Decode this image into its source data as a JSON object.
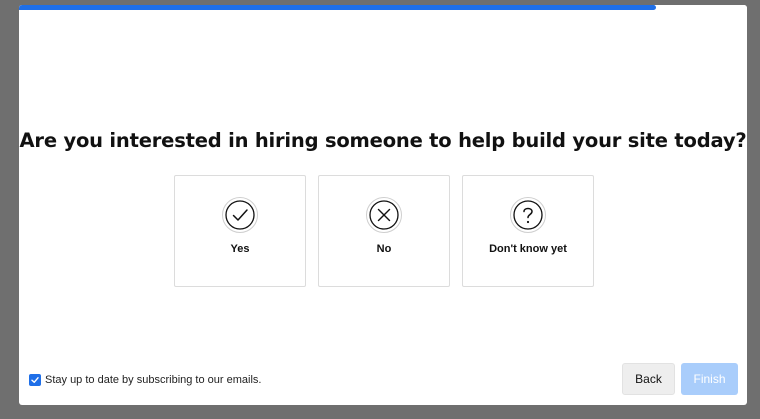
{
  "progress": {
    "value": 0.875,
    "color": "#1f6fe8"
  },
  "question": "Are you interested in hiring someone to help build your site today?",
  "options": [
    {
      "label": "Yes",
      "icon": "check-circle-icon"
    },
    {
      "label": "No",
      "icon": "x-circle-icon"
    },
    {
      "label": "Don't know yet",
      "icon": "question-circle-icon"
    }
  ],
  "subscribe": {
    "checked": true,
    "label": "Stay up to date by subscribing to our emails."
  },
  "buttons": {
    "back": "Back",
    "finish": "Finish"
  },
  "colors": {
    "accent": "#1f6fe8",
    "finish_disabled": "#a9cdfb",
    "overlay": "#6f6f6f"
  }
}
